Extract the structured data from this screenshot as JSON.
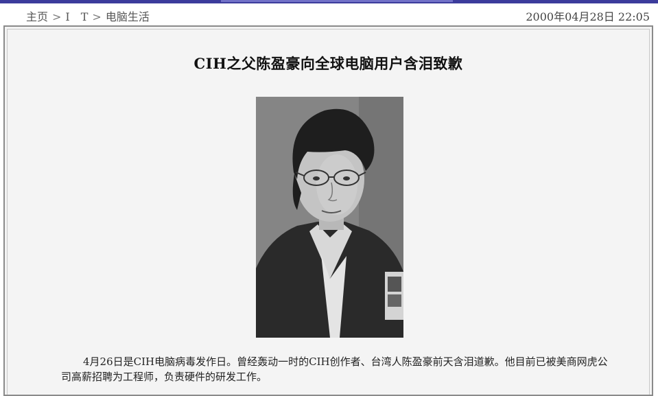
{
  "breadcrumb": {
    "home": "主页",
    "sep1": ">",
    "it": "I　T",
    "sep2": ">",
    "section": "电脑生活"
  },
  "timestamp": "2000年04月28日 22:05",
  "article": {
    "title": "CIH之父陈盈豪向全球电脑用户含泪致歉",
    "photo_icon": "portrait-photo",
    "body": "4月26日是CIH电脑病毒发作日。曾经轰动一时的CIH创作者、台湾人陈盈豪前天含泪道歉。他目前已被美商网虎公司高薪招聘为工程师，负责硬件的研发工作。"
  },
  "colors": {
    "top_bar": "#3c3c9c",
    "panel_bg": "#f4f4f4",
    "border": "#8a8a8a"
  }
}
